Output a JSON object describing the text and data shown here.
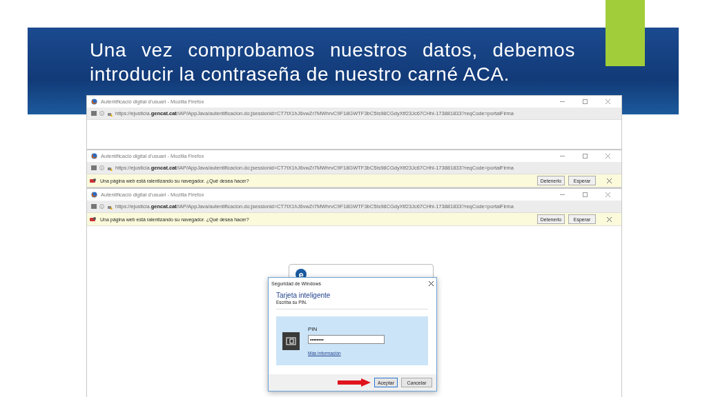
{
  "slide": {
    "title": "Una vez comprobamos nuestros datos, debemos introducir la contraseña de nuestro carné ACA."
  },
  "windows": [
    {
      "title": "Autentificació digital d'usuari - Mozilla Firefox",
      "url": "https://ejusticia.**gencat.cat**/IAP/AppJava/autentificacion.do;jsessionid=CT7tX1hJ6vwZr7MWhrvC9F18GWTF3bC5Is98CGdyXtf23Jc67CHhl-173881833?reqCode=portalFirma"
    },
    {
      "title": "Autentificació digital d'usuari - Mozilla Firefox",
      "url": "https://ejusticia.**gencat.cat**/IAP/AppJava/autentificacion.do;jsessionid=CT7tX1hJ6vwZr7MWhrvC9F18GWTF3bC5Is98CGdyXtf23Jc67CHhl-173881833?reqCode=portalFirma",
      "notification": {
        "message": "Una página web está ralentizando su navegador. ¿Qué desea hacer?",
        "buttons": [
          "Detenerlo",
          "Esperar"
        ]
      }
    },
    {
      "title": "Autentificació digital d'usuari - Mozilla Firefox",
      "url": "https://ejusticia.**gencat.cat**/IAP/AppJava/autentificacion.do;jsessionid=CT7tX1hJ6vwZr7MWhrvC9F18GWTF3bC5Is98CGdyXtf23Jc67CHhl-173881833?reqCode=portalFirma",
      "notification": {
        "message": "Una página web está ralentizando su navegador. ¿Qué desea hacer?",
        "buttons": [
          "Detenerlo",
          "Esperar"
        ]
      },
      "card": {
        "logo": "e"
      },
      "dialog": {
        "title": "Seguridad de Windows",
        "heading": "Tarjeta inteligente",
        "instruction": "Escriba su PIN.",
        "field_label": "PIN",
        "pin_value": "••••••••",
        "link": "Más información",
        "buttons": [
          {
            "label": "Aceptar",
            "selected": true
          },
          {
            "label": "Cancelar",
            "selected": false
          }
        ]
      }
    }
  ]
}
